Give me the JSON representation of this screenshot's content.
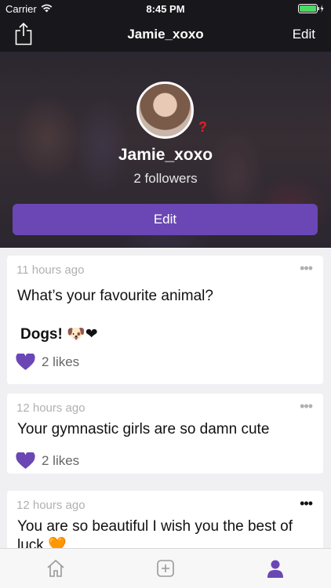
{
  "status": {
    "carrier": "Carrier",
    "time": "8:45 PM"
  },
  "nav": {
    "title": "Jamie_xoxo",
    "edit_label": "Edit"
  },
  "profile": {
    "username": "Jamie_xoxo",
    "followers": "2 followers",
    "edit_label": "Edit",
    "badge": "?"
  },
  "posts": [
    {
      "time": "11 hours ago",
      "text": "What’s your favourite animal?",
      "answer": "Dogs! 🐶❤",
      "likes": "2 likes"
    },
    {
      "time": "12 hours ago",
      "text": "Your gymnastic girls are so damn cute",
      "likes": "2 likes"
    },
    {
      "time": "12 hours ago",
      "text": "You are so beautiful I wish you the best of luck 🧡"
    }
  ],
  "colors": {
    "accent": "#6a47b4",
    "header": "#18181c",
    "heart": "#6a47b4"
  },
  "tabs": [
    "home-icon",
    "add-post-icon",
    "profile-icon"
  ],
  "more_glyph": "•••"
}
